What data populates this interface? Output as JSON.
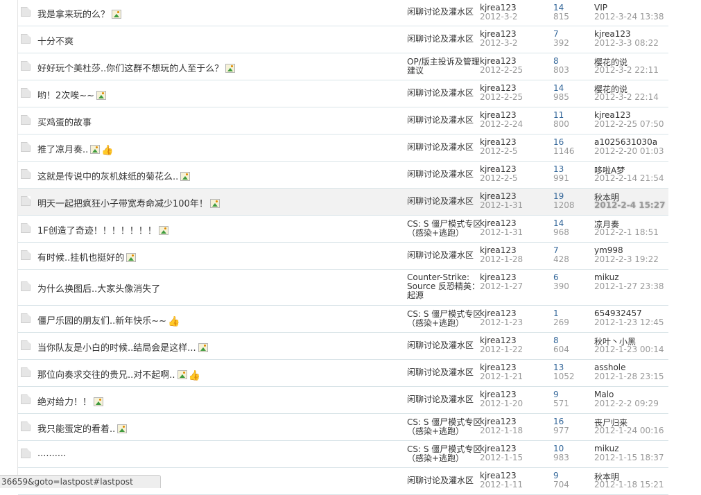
{
  "threads": [
    {
      "title": "我是拿来玩的么？",
      "img": true,
      "thumb": false,
      "forum": [
        "闲聊讨论及灌水区"
      ],
      "author": "kjrea123",
      "post_date": "2012-3-2",
      "replies": "14",
      "views": "815",
      "last_user": "VIP",
      "last_time": "2012-3-24 13:38"
    },
    {
      "title": "十分不爽",
      "img": false,
      "thumb": false,
      "forum": [
        "闲聊讨论及灌水区"
      ],
      "author": "kjrea123",
      "post_date": "2012-3-2",
      "replies": "7",
      "views": "392",
      "last_user": "kjrea123",
      "last_time": "2012-3-3 08:22"
    },
    {
      "title": "好好玩个美杜莎..你们这群不想玩的人至于么？",
      "img": true,
      "thumb": false,
      "forum": [
        "OP/版主投诉及管理",
        "建议"
      ],
      "author": "kjrea123",
      "post_date": "2012-2-25",
      "replies": "8",
      "views": "803",
      "last_user": "樱花的说",
      "last_time": "2012-3-2 22:11"
    },
    {
      "title": "哟！2次唉~~",
      "img": true,
      "thumb": false,
      "forum": [
        "闲聊讨论及灌水区"
      ],
      "author": "kjrea123",
      "post_date": "2012-2-25",
      "replies": "14",
      "views": "985",
      "last_user": "樱花的说",
      "last_time": "2012-3-2 22:14"
    },
    {
      "title": "买鸡蛋的故事",
      "img": false,
      "thumb": false,
      "forum": [
        "闲聊讨论及灌水区"
      ],
      "author": "kjrea123",
      "post_date": "2012-2-24",
      "replies": "11",
      "views": "800",
      "last_user": "kjrea123",
      "last_time": "2012-2-25 07:50"
    },
    {
      "title": "推了凉月奏..",
      "img": true,
      "thumb": true,
      "forum": [
        "闲聊讨论及灌水区"
      ],
      "author": "kjrea123",
      "post_date": "2012-2-5",
      "replies": "16",
      "views": "1146",
      "last_user": "a1025631030a",
      "last_time": "2012-2-20 01:03"
    },
    {
      "title": "这就是传说中的灰机妹纸的菊花么..",
      "img": true,
      "thumb": false,
      "forum": [
        "闲聊讨论及灌水区"
      ],
      "author": "kjrea123",
      "post_date": "2012-2-5",
      "replies": "13",
      "views": "991",
      "last_user": "哆啦A梦",
      "last_time": "2012-2-14 21:54"
    },
    {
      "title": "明天一起把疯狂小子带宽寿命减少100年！",
      "img": true,
      "thumb": false,
      "forum": [
        "闲聊讨论及灌水区"
      ],
      "author": "kjrea123",
      "post_date": "2012-1-31",
      "replies": "19",
      "views": "1208",
      "last_user": "秋本明",
      "last_time": "2012-2-4 15:27"
    },
    {
      "title": "1F创造了奇迹！！！！！！！",
      "img": true,
      "thumb": false,
      "forum": [
        "CS: S 僵尸模式专区",
        "（感染+逃跑）"
      ],
      "author": "kjrea123",
      "post_date": "2012-1-31",
      "replies": "14",
      "views": "968",
      "last_user": "凉月奏",
      "last_time": "2012-2-1 18:51"
    },
    {
      "title": "有时候..挂机也挺好的",
      "img": true,
      "thumb": false,
      "forum": [
        "闲聊讨论及灌水区"
      ],
      "author": "kjrea123",
      "post_date": "2012-1-28",
      "replies": "7",
      "views": "428",
      "last_user": "ym998",
      "last_time": "2012-2-3 19:22"
    },
    {
      "title": "为什么换图后..大家头像消失了",
      "img": false,
      "thumb": false,
      "forum": [
        "Counter-Strike:",
        "Source 反恐精英：",
        "起源"
      ],
      "author": "kjrea123",
      "post_date": "2012-1-27",
      "replies": "6",
      "views": "390",
      "last_user": "mikuz",
      "last_time": "2012-1-27 23:38"
    },
    {
      "title": "僵尸乐园的朋友们..新年快乐~~",
      "img": false,
      "thumb": true,
      "forum": [
        "CS: S 僵尸模式专区",
        "（感染+逃跑）"
      ],
      "author": "kjrea123",
      "post_date": "2012-1-23",
      "replies": "1",
      "views": "269",
      "last_user": "654932457",
      "last_time": "2012-1-23 12:45"
    },
    {
      "title": "当你队友是小白的时候..结局会是这样...",
      "img": true,
      "thumb": false,
      "forum": [
        "闲聊讨论及灌水区"
      ],
      "author": "kjrea123",
      "post_date": "2012-1-22",
      "replies": "8",
      "views": "604",
      "last_user": "秋叶丶小黑",
      "last_time": "2012-1-23 00:14"
    },
    {
      "title": "那位向奏求交往的贵兄..对不起啊..",
      "img": true,
      "thumb": true,
      "forum": [
        "闲聊讨论及灌水区"
      ],
      "author": "kjrea123",
      "post_date": "2012-1-21",
      "replies": "13",
      "views": "1052",
      "last_user": "asshole",
      "last_time": "2012-1-28 23:15"
    },
    {
      "title": "绝对给力！！",
      "img": true,
      "thumb": false,
      "forum": [
        "闲聊讨论及灌水区"
      ],
      "author": "kjrea123",
      "post_date": "2012-1-20",
      "replies": "9",
      "views": "571",
      "last_user": "Malo",
      "last_time": "2012-2-2 09:29"
    },
    {
      "title": "我只能蛋定的看着..",
      "img": true,
      "thumb": false,
      "forum": [
        "CS: S 僵尸模式专区",
        "（感染+逃跑）"
      ],
      "author": "kjrea123",
      "post_date": "2012-1-18",
      "replies": "16",
      "views": "977",
      "last_user": "丧尸归来",
      "last_time": "2012-1-24 00:16"
    },
    {
      "title": "..........",
      "img": false,
      "thumb": false,
      "forum": [
        "CS: S 僵尸模式专区",
        "（感染+逃跑）"
      ],
      "author": "kjrea123",
      "post_date": "2012-1-15",
      "replies": "10",
      "views": "983",
      "last_user": "mikuz",
      "last_time": "2012-1-15 18:37"
    },
    {
      "title": "",
      "img": false,
      "thumb": false,
      "forum": [
        "闲聊讨论及灌水区"
      ],
      "author": "kjrea123",
      "post_date": "2012-1-11",
      "replies": "9",
      "views": "704",
      "last_user": "秋本明",
      "last_time": "2012-1-18 15:21"
    }
  ],
  "status_bar": {
    "url": "36659&goto=lastpost#lastpost"
  }
}
